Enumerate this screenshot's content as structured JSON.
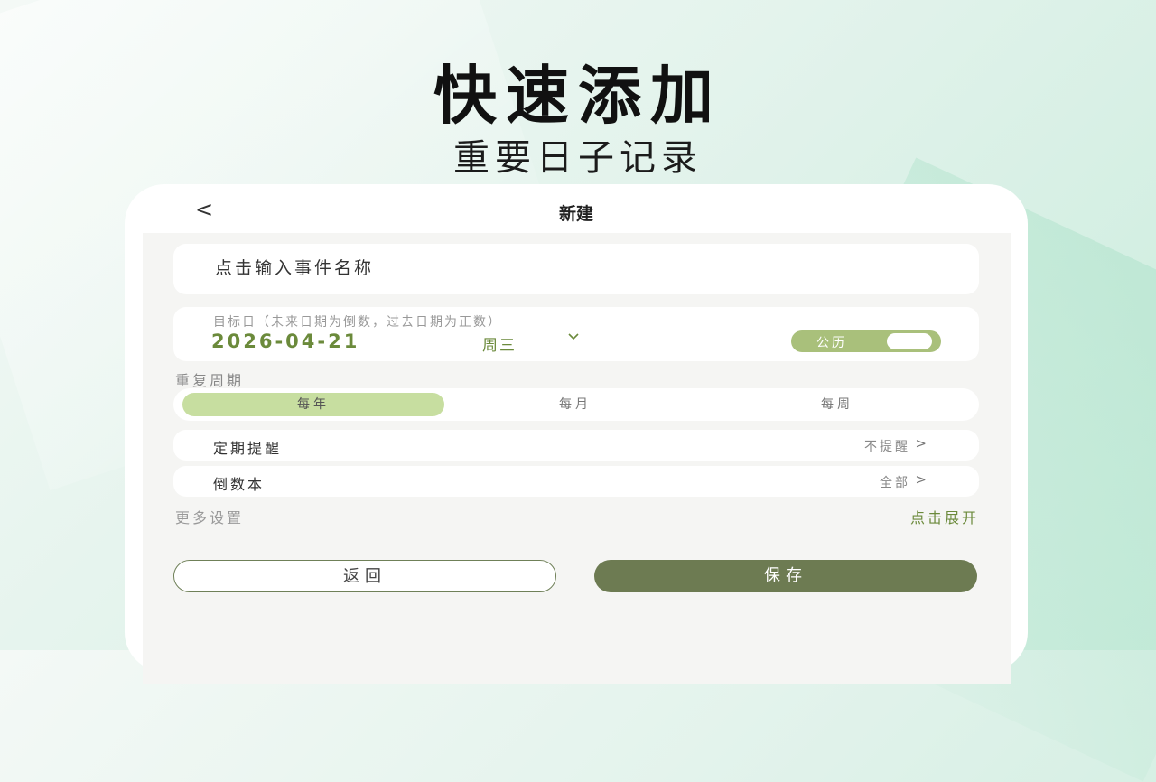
{
  "hero": {
    "title": "快速添加",
    "subtitle": "重要日子记录"
  },
  "nav": {
    "back_icon": "<",
    "title": "新建"
  },
  "form": {
    "event_name_placeholder": "点击输入事件名称",
    "target_date_label": "目标日（未来日期为倒数，过去日期为正数）",
    "date": "2026-04-21",
    "weekday": "周三",
    "calendar_toggle_label": "公历",
    "repeat_label": "重复周期",
    "repeat_options": [
      "每年",
      "每月",
      "每周"
    ],
    "repeat_selected": "每年",
    "reminder_label": "定期提醒",
    "reminder_value": "不提醒",
    "book_label": "倒数本",
    "book_value": "全部",
    "more_settings_label": "更多设置",
    "expand_label": "点击展开"
  },
  "buttons": {
    "back": "返回",
    "save": "保存"
  },
  "colors": {
    "accent": "#6b8a3b",
    "toggle": "#a9c07b",
    "selected_segment": "#c7dea0",
    "save_button": "#6d7b52"
  }
}
